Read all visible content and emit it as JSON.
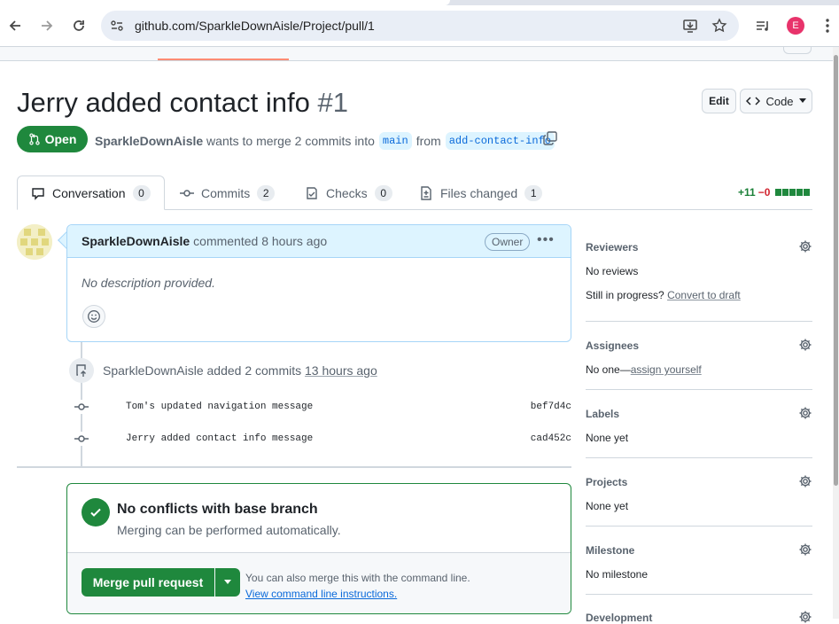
{
  "browser": {
    "url": "github.com/SparkleDownAisle/Project/pull/1",
    "profile_initial": "E",
    "icons": [
      "back-arrow-icon",
      "forward-arrow-icon",
      "reload-icon",
      "site-info-icon",
      "install-app-icon",
      "bookmark-star-icon",
      "reading-list-icon",
      "menu-kebab-icon"
    ]
  },
  "pr": {
    "title": "Jerry added contact info",
    "number": "#1",
    "edit_label": "Edit",
    "code_label": "Code",
    "state": "Open",
    "author": "SparkleDownAisle",
    "merge_text": "wants to merge 2 commits into",
    "base_branch": "main",
    "from_text": "from",
    "head_branch": "add-contact-info"
  },
  "tabs": [
    {
      "label": "Conversation",
      "count": "0",
      "icon": "comment-icon"
    },
    {
      "label": "Commits",
      "count": "2",
      "icon": "commit-icon"
    },
    {
      "label": "Checks",
      "count": "0",
      "icon": "checklist-icon"
    },
    {
      "label": "Files changed",
      "count": "1",
      "icon": "file-diff-icon"
    }
  ],
  "diffstat": {
    "additions": "+11",
    "deletions": "−0"
  },
  "comment": {
    "author": "SparkleDownAisle",
    "action": "commented 8 hours ago",
    "badge": "Owner",
    "body": "No description provided."
  },
  "timeline": {
    "actor": "SparkleDownAisle",
    "action": "added 2 commits",
    "time": "13 hours ago",
    "commits": [
      {
        "message": "Tom's updated navigation message",
        "sha": "bef7d4c"
      },
      {
        "message": "Jerry added contact info message",
        "sha": "cad452c"
      }
    ]
  },
  "merge": {
    "title": "No conflicts with base branch",
    "subtitle": "Merging can be performed automatically.",
    "button": "Merge pull request",
    "hint": "You can also merge this with the command line.",
    "hint_link": "View command line instructions."
  },
  "sidebar": {
    "reviewers": {
      "title": "Reviewers",
      "value": "No reviews",
      "value2_prefix": "Still in progress?",
      "value2_link": "Convert to draft"
    },
    "assignees": {
      "title": "Assignees",
      "value_prefix": "No one—",
      "value_link": "assign yourself"
    },
    "labels": {
      "title": "Labels",
      "value": "None yet"
    },
    "projects": {
      "title": "Projects",
      "value": "None yet"
    },
    "milestone": {
      "title": "Milestone",
      "value": "No milestone"
    },
    "development": {
      "title": "Development"
    }
  },
  "colors": {
    "open_green": "#1f883d",
    "link_blue": "#0969da",
    "comment_header": "#ddf4ff"
  }
}
